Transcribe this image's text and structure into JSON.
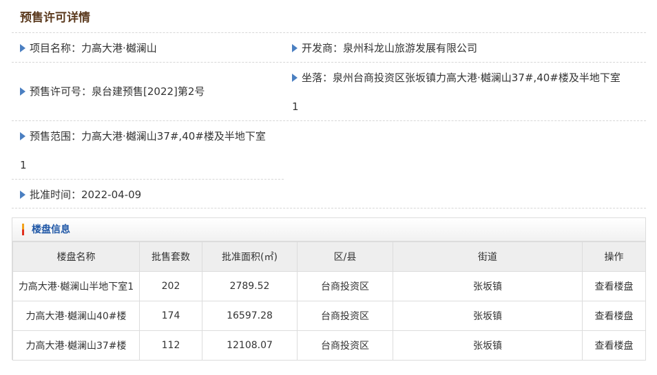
{
  "page_title": "预售许可详情",
  "fields": {
    "project_name": "项目名称：力高大港·樾澜山",
    "developer": "开发商：泉州科龙山旅游发展有限公司",
    "permit_no": "预售许可号：泉台建预售[2022]第2号",
    "location_line1": "坐落：泉州台商投资区张坂镇力高大港·樾澜山37#,40#楼及半地下室",
    "location_line2": "1",
    "scope_line1": "预售范围：力高大港·樾澜山37#,40#楼及半地下室",
    "scope_line2": "1",
    "approve_time": "批准时间：2022-04-09"
  },
  "panel": {
    "title": "楼盘信息",
    "columns": [
      "楼盘名称",
      "批售套数",
      "批准面积(㎡)",
      "区/县",
      "街道",
      "操作"
    ],
    "rows": [
      [
        "力高大港·樾澜山半地下室1",
        "202",
        "2789.52",
        "台商投资区",
        "张坂镇",
        "查看楼盘"
      ],
      [
        "力高大港·樾澜山40#楼",
        "174",
        "16597.28",
        "台商投资区",
        "张坂镇",
        "查看楼盘"
      ],
      [
        "力高大港·樾澜山37#楼",
        "112",
        "12108.07",
        "台商投资区",
        "张坂镇",
        "查看楼盘"
      ]
    ]
  },
  "colors": {
    "title_brown": "#5b3a1e",
    "arrow_blue": "#4a7fc1",
    "panel_title_blue": "#1f57a6"
  }
}
